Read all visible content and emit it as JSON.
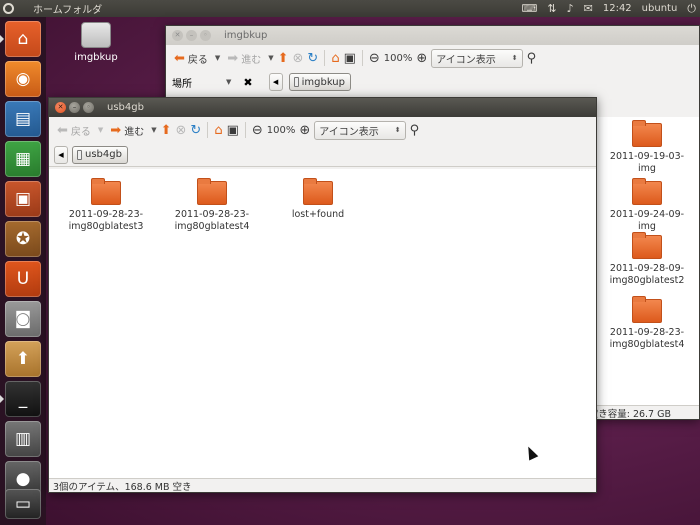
{
  "top_panel": {
    "title": "ホームフォルダ",
    "time": "12:42",
    "user": "ubuntu",
    "icons": [
      "keyboard-icon",
      "network-icon",
      "volume-icon",
      "mail-icon",
      "power-icon"
    ]
  },
  "desktop": {
    "icon_label": "imgbkup"
  },
  "bg_window": {
    "title": "imgbkup",
    "back_label": "戻る",
    "forward_label": "進む",
    "zoom": "100%",
    "view_mode": "アイコン表示",
    "places_label": "場所",
    "crumb": "imgbkup",
    "folders": [
      "2011-09-19-03-img",
      "2011-09-24-09-img",
      "2011-09-28-09-img80gblatest2",
      "2011-09-28-23-img80gblatest4"
    ],
    "folder_lines": [
      [
        "2011-09-19-03-img"
      ],
      [
        "2011-09-24-09-img"
      ],
      [
        "2011-09-28-09-",
        "img80gblatest2"
      ],
      [
        "2011-09-28-23-",
        "img80gblatest4"
      ]
    ],
    "status": "空き容量: 26.7 GB"
  },
  "fg_window": {
    "title": "usb4gb",
    "back_label": "戻る",
    "forward_label": "進む",
    "zoom": "100%",
    "view_mode": "アイコン表示",
    "crumb": "usb4gb",
    "folders": [
      {
        "line1": "2011-09-28-23-",
        "line2": "img80gblatest3"
      },
      {
        "line1": "2011-09-28-23-",
        "line2": "img80gblatest4"
      },
      {
        "line1": "lost+found",
        "line2": ""
      }
    ],
    "status": "3個のアイテム、168.6 MB 空き"
  },
  "colors": {
    "accent_orange": "#e66a1e",
    "titlebar_dark": "#3c3b37",
    "desktop_purple": "#5d1f4c"
  }
}
